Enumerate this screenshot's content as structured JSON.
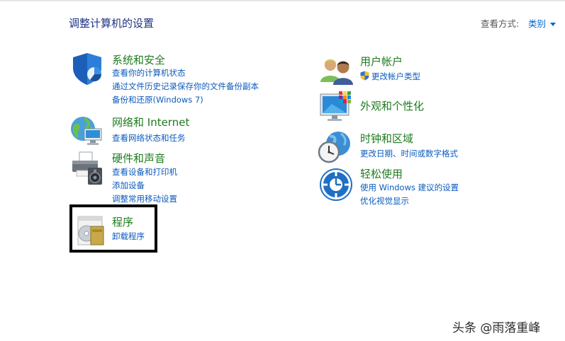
{
  "header": {
    "title": "调整计算机的设置",
    "view_by_label": "查看方式:",
    "view_by_value": "类别"
  },
  "categories": {
    "security": {
      "title": "系统和安全",
      "links": [
        "查看你的计算机状态",
        "通过文件历史记录保存你的文件备份副本",
        "备份和还原(Windows 7)"
      ]
    },
    "network": {
      "title": "网络和 Internet",
      "links": [
        "查看网络状态和任务"
      ]
    },
    "hardware": {
      "title": "硬件和声音",
      "links": [
        "查看设备和打印机",
        "添加设备",
        "调整常用移动设置"
      ]
    },
    "programs": {
      "title": "程序",
      "links": [
        "卸载程序"
      ]
    },
    "users": {
      "title": "用户帐户",
      "links": [
        "更改帐户类型"
      ]
    },
    "appearance": {
      "title": "外观和个性化",
      "links": []
    },
    "clock": {
      "title": "时钟和区域",
      "links": [
        "更改日期、时间或数字格式"
      ]
    },
    "ease": {
      "title": "轻松使用",
      "links": [
        "使用 Windows 建议的设置",
        "优化视觉显示"
      ]
    }
  },
  "watermark": "头条 @雨落重峰"
}
